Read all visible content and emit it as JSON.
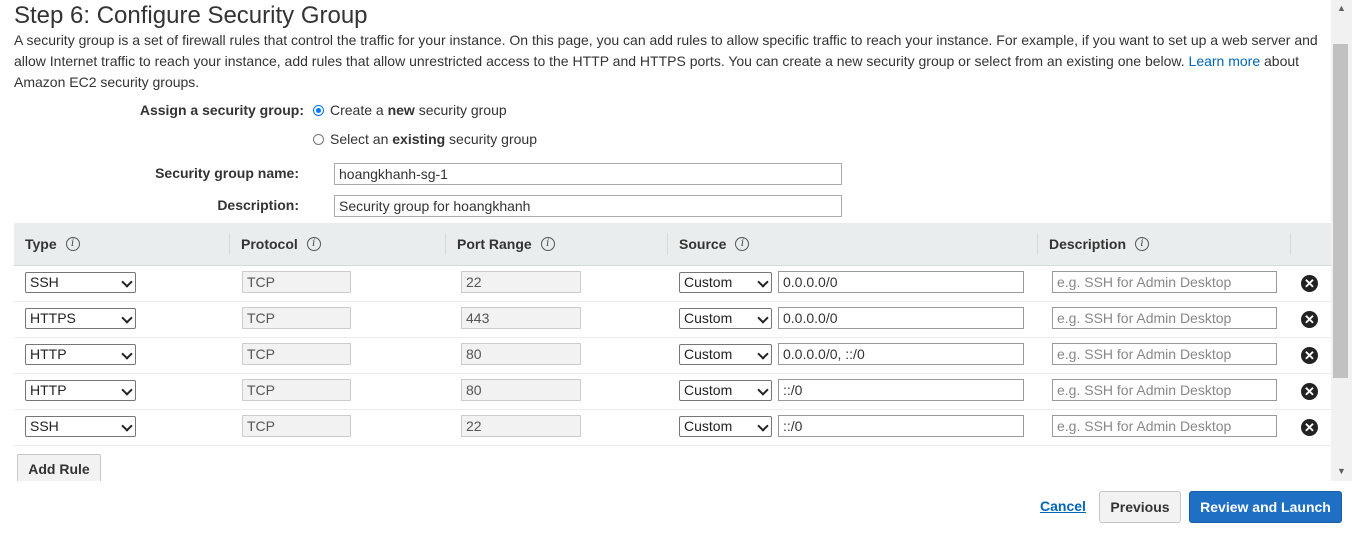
{
  "page": {
    "title": "Step 6: Configure Security Group",
    "intro_before_link": "A security group is a set of firewall rules that control the traffic for your instance. On this page, you can add rules to allow specific traffic to reach your instance. For example, if you want to set up a web server and allow Internet traffic to reach your instance, add rules that allow unrestricted access to the HTTP and HTTPS ports. You can create a new security group or select from an existing one below.",
    "learn_more_link": "Learn more",
    "intro_after_link": "about Amazon EC2 security groups."
  },
  "assign": {
    "label": "Assign a security group:",
    "option_new": {
      "pre": "Create a ",
      "bold": "new",
      "post": " security group",
      "selected": true
    },
    "option_existing": {
      "pre": "Select an ",
      "bold": "existing",
      "post": " security group",
      "selected": false
    }
  },
  "group": {
    "name_label": "Security group name:",
    "name_value": "hoangkhanh-sg-1",
    "description_label": "Description:",
    "description_value": "Security group for hoangkhanh"
  },
  "table": {
    "columns": [
      "Type",
      "Protocol",
      "Port Range",
      "Source",
      "Description"
    ],
    "info_glyph": "i",
    "description_placeholder": "e.g. SSH for Admin Desktop",
    "remove_glyph": "✕",
    "rows": [
      {
        "type": "SSH",
        "protocol": "TCP",
        "port": "22",
        "source_mode": "Custom",
        "source": "0.0.0.0/0"
      },
      {
        "type": "HTTPS",
        "protocol": "TCP",
        "port": "443",
        "source_mode": "Custom",
        "source": "0.0.0.0/0"
      },
      {
        "type": "HTTP",
        "protocol": "TCP",
        "port": "80",
        "source_mode": "Custom",
        "source": "0.0.0.0/0, ::/0"
      },
      {
        "type": "HTTP",
        "protocol": "TCP",
        "port": "80",
        "source_mode": "Custom",
        "source": "::/0"
      },
      {
        "type": "SSH",
        "protocol": "TCP",
        "port": "22",
        "source_mode": "Custom",
        "source": "::/0"
      }
    ]
  },
  "buttons": {
    "add_rule": "Add Rule",
    "cancel": "Cancel",
    "previous": "Previous",
    "review_launch": "Review and Launch"
  },
  "scrollbar": {
    "up_glyph": "▲",
    "down_glyph": "▼"
  },
  "colors": {
    "link": "#0066bb",
    "primary": "#1f6fc5",
    "header_bg": "#eaeded"
  }
}
